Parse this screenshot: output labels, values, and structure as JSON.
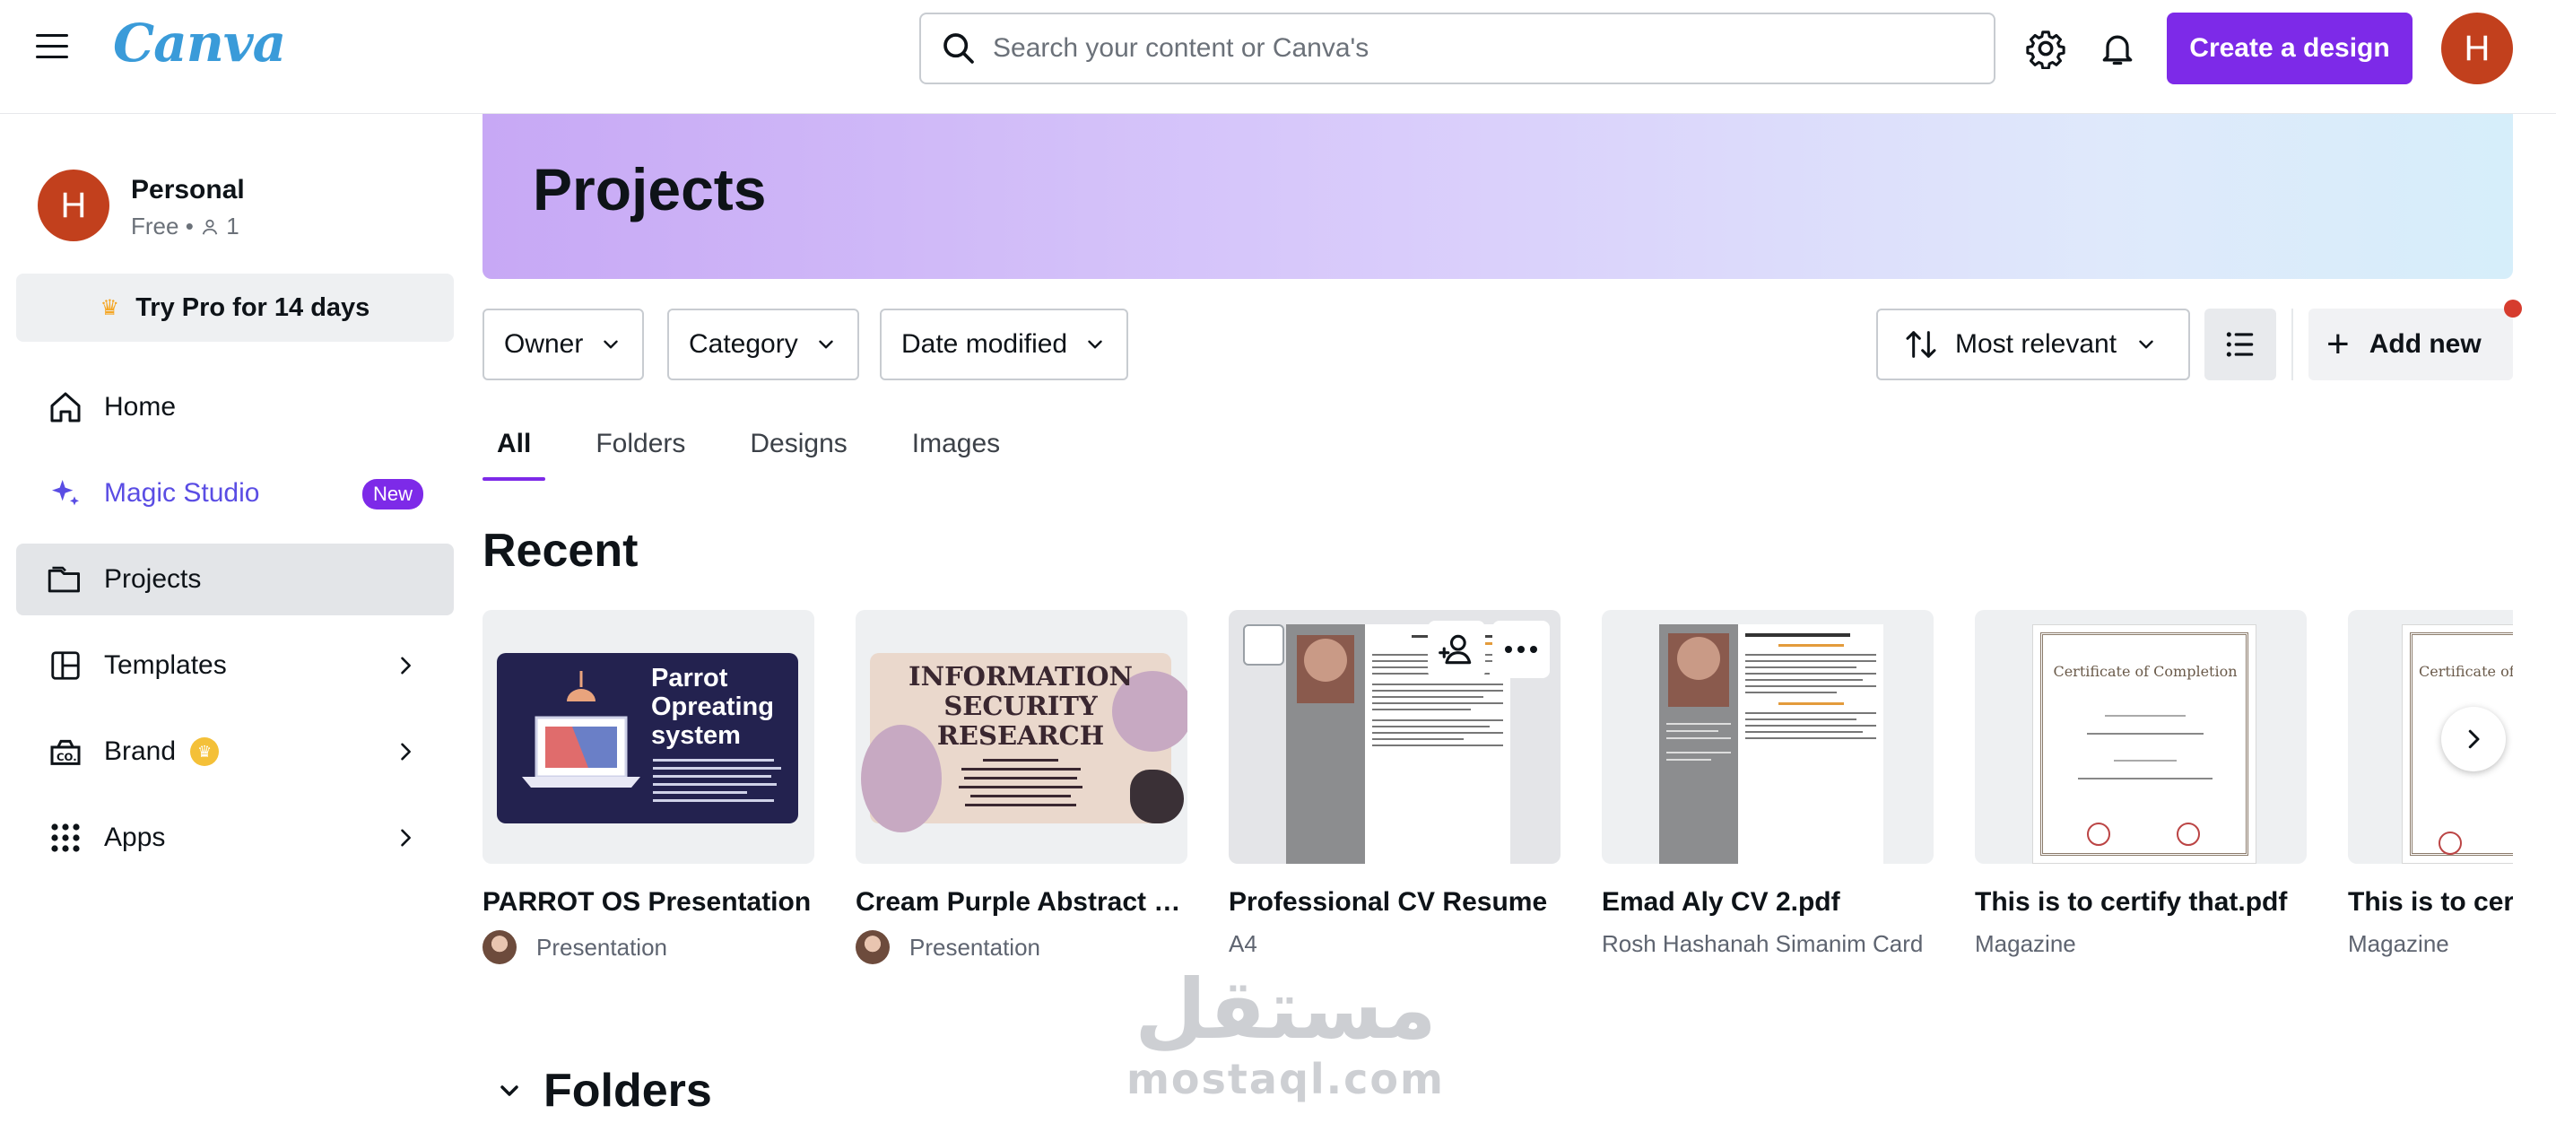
{
  "header": {
    "logo": "Canva",
    "search_placeholder": "Search your content or Canva's",
    "create_label": "Create a design",
    "avatar_initial": "H"
  },
  "sidebar": {
    "account": {
      "initial": "H",
      "name": "Personal",
      "plan": "Free",
      "members": "1"
    },
    "try_pro": "Try Pro for 14 days",
    "items": [
      {
        "label": "Home"
      },
      {
        "label": "Magic Studio",
        "badge": "New"
      },
      {
        "label": "Projects"
      },
      {
        "label": "Templates"
      },
      {
        "label": "Brand"
      },
      {
        "label": "Apps"
      }
    ]
  },
  "main": {
    "title": "Projects",
    "filters": [
      "Owner",
      "Category",
      "Date modified"
    ],
    "sort_label": "Most relevant",
    "add_new": "Add new",
    "tabs": [
      "All",
      "Folders",
      "Designs",
      "Images"
    ],
    "recent_title": "Recent",
    "folders_title": "Folders",
    "cards": [
      {
        "title": "PARROT OS  Presentation",
        "subtitle": "Presentation",
        "thumb_lines": [
          "Parrot",
          "Opreating",
          "system"
        ]
      },
      {
        "title": "Cream Purple Abstract T...",
        "subtitle": "Presentation",
        "thumb_lines": [
          "INFORMATION",
          "SECURITY",
          "RESEARCH"
        ]
      },
      {
        "title": "Professional CV Resume",
        "subtitle": "A4"
      },
      {
        "title": "Emad Aly CV 2.pdf",
        "subtitle": "Rosh Hashanah Simanim Card"
      },
      {
        "title": "This is to certify that.pdf",
        "subtitle": "Magazine",
        "thumb_lines": [
          "Certificate of Completion"
        ]
      },
      {
        "title": "This is to certify that.pdf",
        "subtitle": "Magazine",
        "thumb_lines": [
          "Certificate of"
        ]
      }
    ]
  },
  "watermark": {
    "arabic": "مستقل",
    "latin": "mostaql.com"
  },
  "colors": {
    "accent": "#7d2ae8",
    "avatar": "#c2401d",
    "magic": "#5a4de4"
  }
}
